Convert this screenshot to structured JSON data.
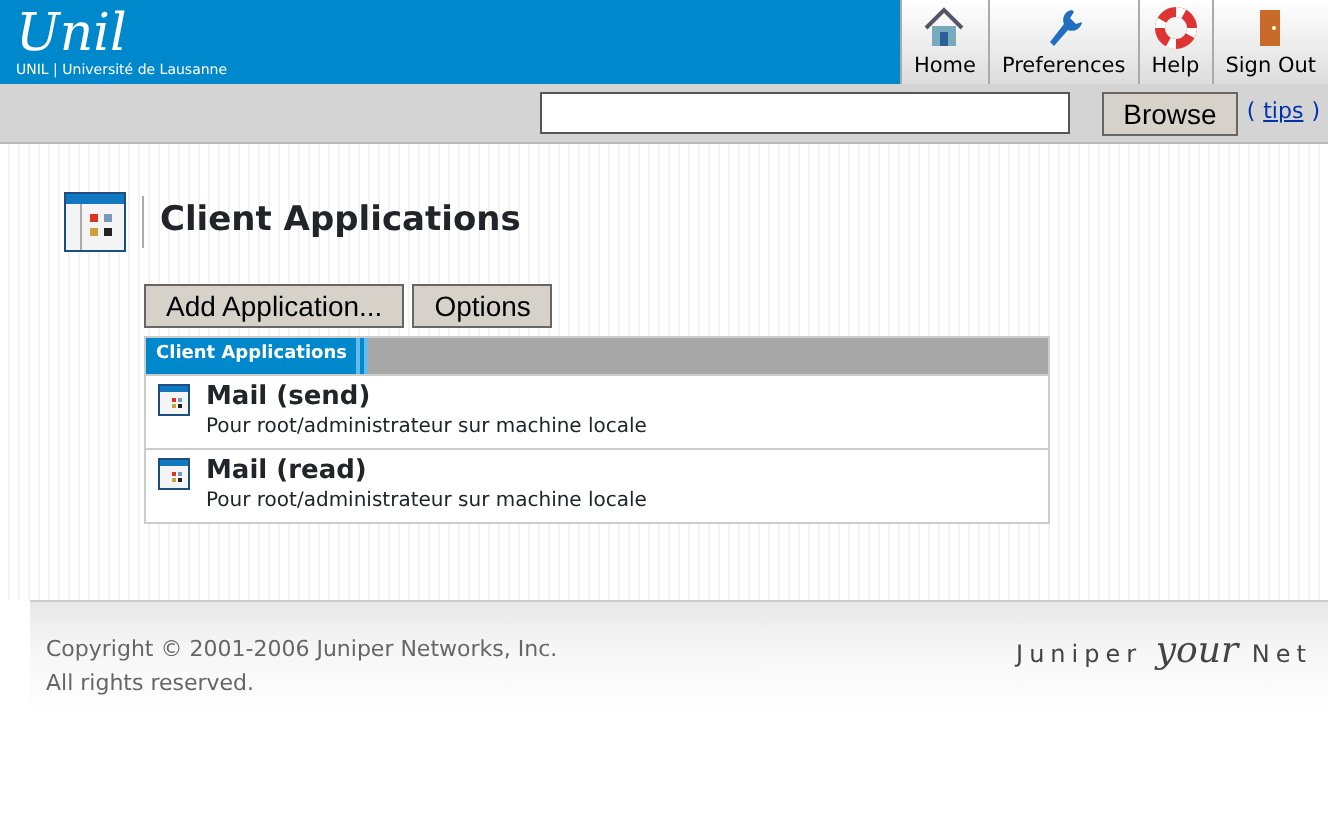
{
  "header": {
    "logo": "Unil",
    "subtitle": "UNIL | Université de Lausanne",
    "nav": [
      {
        "kind": "home",
        "label": "Home"
      },
      {
        "kind": "wrench",
        "label": "Preferences"
      },
      {
        "kind": "help",
        "label": "Help"
      },
      {
        "kind": "door",
        "label": "Sign Out"
      }
    ]
  },
  "search": {
    "button": "Browse",
    "tips_open": "(",
    "tips": "tips",
    "tips_close": ")"
  },
  "page_title": "Client Applications",
  "buttons": [
    "Add Application...",
    "Options"
  ],
  "panel": {
    "tab": "Client Applications",
    "items": [
      {
        "name": "Mail (send)",
        "description": "Pour root/administrateur sur machine locale"
      },
      {
        "name": "Mail (read)",
        "description": "Pour root/administrateur sur machine locale"
      }
    ]
  },
  "footer": {
    "copyright": "Copyright © 2001-2006 Juniper Networks, Inc.",
    "rights": "All rights reserved.",
    "brand": [
      "Juniper",
      "your",
      "Net"
    ]
  }
}
